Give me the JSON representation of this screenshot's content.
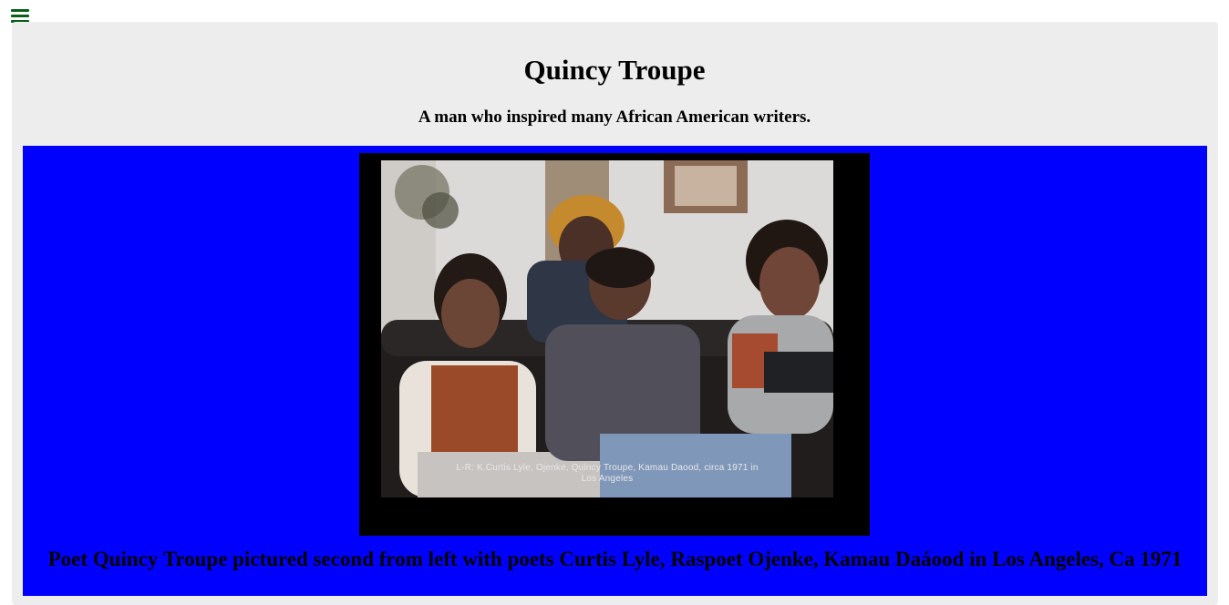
{
  "nav": {
    "menu_icon": "hamburger-menu-icon",
    "menu_color": "#0a5f18"
  },
  "header": {
    "title": "Quincy Troupe",
    "subtitle": "A man who inspired many African American writers."
  },
  "figure": {
    "background": "#0000ff",
    "photo_overlay_text": "L-R: K.Curtis Lyle, Ojenke, Quincy Troupe, Kamau Daood, circa 1971 in Los Angeles",
    "caption": "Poet Quincy Troupe pictured second from left with poets Curtis Lyle, Raspoet Ojenke, Kamau Daáood in Los Angeles, Ca 1971"
  }
}
